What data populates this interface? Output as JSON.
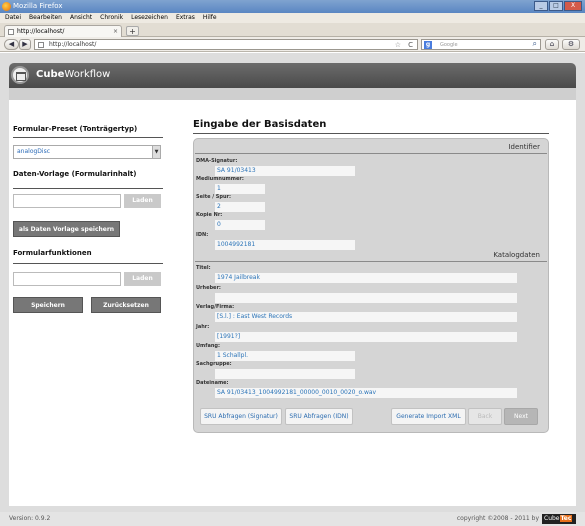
{
  "window": {
    "title": "Mozilla Firefox",
    "buttons": [
      "_",
      "□",
      "X"
    ]
  },
  "menu": [
    "Datei",
    "Bearbeiten",
    "Ansicht",
    "Chronik",
    "Lesezeichen",
    "Extras",
    "Hilfe"
  ],
  "tab": {
    "label": "http://localhost/",
    "close": "×",
    "new_tab": "+"
  },
  "nav": {
    "back": "◀",
    "forward": "▶",
    "url": "http://localhost/",
    "star": "☆",
    "reload": "C",
    "search_placeholder": "Google",
    "search_engine": "g",
    "home": "⌂",
    "addons": "⚙"
  },
  "app": {
    "brand_bold": "Cube",
    "brand_rest": "Workflow"
  },
  "sidebar": {
    "preset_heading": "Formular-Preset (Tonträgertyp)",
    "preset_value": "analogDisc",
    "template_heading": "Daten-Vorlage (Formularinhalt)",
    "load_label": "Laden",
    "save_template_label": "als Daten Vorlage speichern",
    "functions_heading": "Formularfunktionen",
    "load2_label": "Laden",
    "save_label": "Speichern",
    "reset_label": "Zurücksetzen"
  },
  "main": {
    "heading": "Eingabe der Basisdaten",
    "identifier_heading": "Identifier",
    "catalog_heading": "Katalogdaten",
    "identifier_fields": [
      {
        "label": "DMA-Signatur:",
        "value": "SA 91/03413"
      },
      {
        "label": "Mediumnummer:",
        "value": "1"
      },
      {
        "label": "Seite / Spur:",
        "value": "2"
      },
      {
        "label": "Kopie Nr:",
        "value": "0"
      },
      {
        "label": "IDN:",
        "value": "1004992181"
      }
    ],
    "catalog_fields": [
      {
        "label": "Titel:",
        "value": "1974 Jailbreak"
      },
      {
        "label": "Urheber:",
        "value": ""
      },
      {
        "label": "Verlag/Firma:",
        "value": "[S.l.]  : East West Records"
      },
      {
        "label": "Jahr:",
        "value": "[1991?]"
      },
      {
        "label": "Umfang:",
        "value": "1 Schallpl."
      },
      {
        "label": "Sachgruppe:",
        "value": ""
      },
      {
        "label": "Dateiname:",
        "value": "SA 91/03413_1004992181_00000_0010_0020_o.wav"
      }
    ],
    "buttons": {
      "sru_signatur": "SRU Abfragen (Signatur)",
      "sru_idn": "SRU Abfragen (IDN)",
      "generate_xml": "Generate Import XML",
      "back": "Back",
      "next": "Next"
    }
  },
  "footer": {
    "version": "Version: 0.9.2",
    "copyright": "copyright ©2008 - 2011 by",
    "logo_a": "Cube",
    "logo_b": "Tec"
  }
}
